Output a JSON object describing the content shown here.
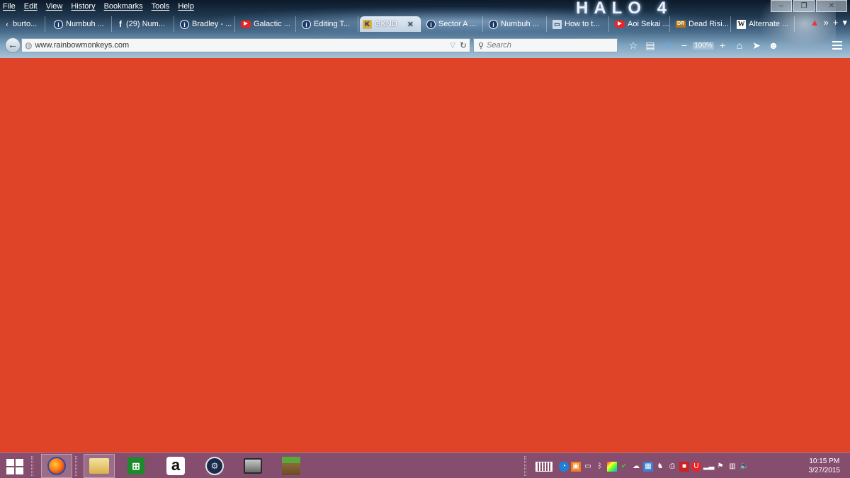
{
  "menu": [
    "File",
    "Edit",
    "View",
    "History",
    "Bookmarks",
    "Tools",
    "Help"
  ],
  "theme_logo_text": "HALO 4",
  "window_controls": {
    "minimize": "–",
    "maximize": "❐",
    "close": "✕"
  },
  "tabs": [
    {
      "label": "burto...",
      "icon": "back-arrow-icon"
    },
    {
      "label": "Numbuh ...",
      "icon": "wikia-icon"
    },
    {
      "label": "(29) Num...",
      "icon": "facebook-icon"
    },
    {
      "label": "Bradley - ...",
      "icon": "wikia-icon"
    },
    {
      "label": "Galactic ...",
      "icon": "youtube-icon"
    },
    {
      "label": "Editing T...",
      "icon": "wikia-icon"
    },
    {
      "label": "GKND",
      "icon": "knd-icon",
      "active": true
    },
    {
      "label": "Sector A ...",
      "icon": "wikia-icon"
    },
    {
      "label": "Numbuh ...",
      "icon": "wikia-icon"
    },
    {
      "label": "How to t...",
      "icon": "computer-icon"
    },
    {
      "label": "Aoi Sekai ...",
      "icon": "youtube-icon"
    },
    {
      "label": "Dead Risi...",
      "icon": "dead-rising-icon"
    },
    {
      "label": "Alternate ...",
      "icon": "wikipedia-icon"
    }
  ],
  "nav": {
    "url": "www.rainbowmonkeys.com",
    "search_placeholder": "Search",
    "zoom": "100%"
  },
  "taskbar": {
    "apps": [
      "firefox-icon",
      "file-explorer-icon",
      "store-icon",
      "amazon-icon",
      "steam-icon",
      "window-icon",
      "minecraft-icon"
    ],
    "clock_time": "10:15 PM",
    "clock_date": "3/27/2015"
  }
}
